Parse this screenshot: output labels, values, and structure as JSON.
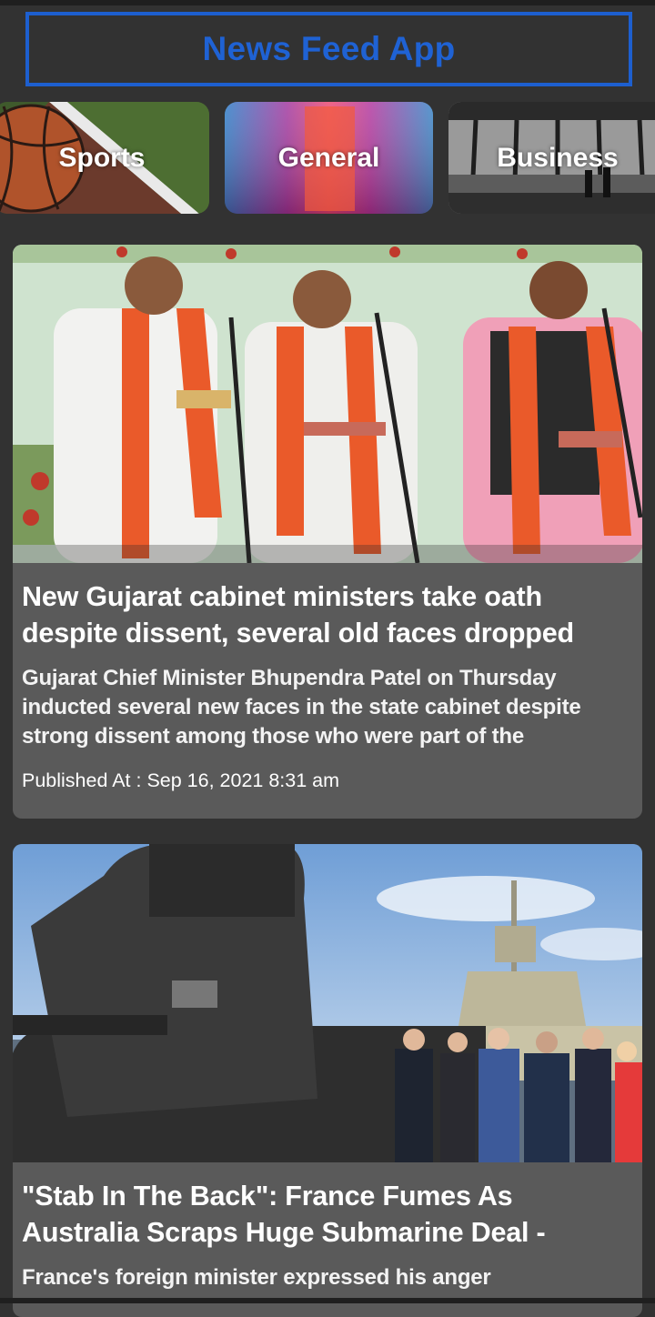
{
  "header": {
    "title": "News Feed App"
  },
  "categories": [
    {
      "label": "Sports",
      "icon": "basketball-image"
    },
    {
      "label": "General",
      "icon": "gradient-image"
    },
    {
      "label": "Business",
      "icon": "office-window-image"
    }
  ],
  "articles": [
    {
      "title": "New Gujarat cabinet ministers take oath despite dissent, several old faces dropped",
      "description": "Gujarat Chief Minister Bhupendra Patel on Thursday inducted several new faces in the state cabinet despite strong dissent among those who were part of the",
      "published": "Published At : Sep 16, 2021 8:31 am"
    },
    {
      "title": "\"Stab In The Back\": France Fumes As Australia Scraps Huge Submarine Deal -",
      "description": "France's foreign minister expressed his anger"
    }
  ],
  "colors": {
    "accent": "#1f62d4",
    "background": "#323232",
    "card": "#5a5a5a"
  }
}
